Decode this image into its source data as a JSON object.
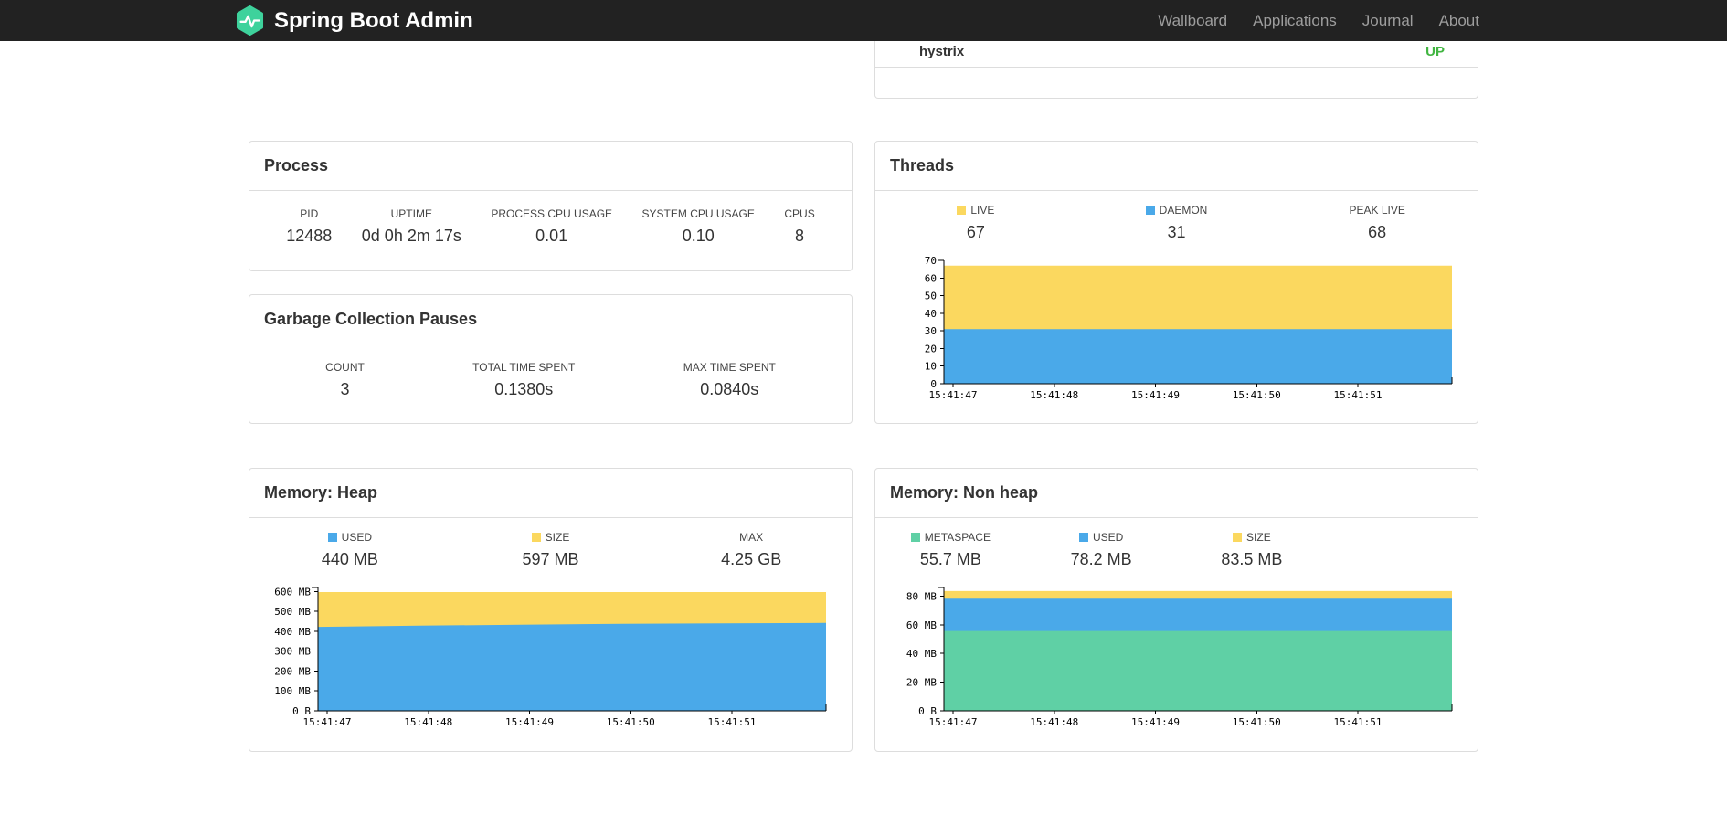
{
  "navbar": {
    "brand": "Spring Boot Admin",
    "links": [
      "Wallboard",
      "Applications",
      "Journal",
      "About"
    ]
  },
  "status_card": {
    "service": "hystrix",
    "status": "UP",
    "status_color": "#41b541"
  },
  "process": {
    "title": "Process",
    "metrics": [
      {
        "label": "PID",
        "value": "12488"
      },
      {
        "label": "UPTIME",
        "value": "0d 0h 2m 17s"
      },
      {
        "label": "PROCESS CPU USAGE",
        "value": "0.01"
      },
      {
        "label": "SYSTEM CPU USAGE",
        "value": "0.10"
      },
      {
        "label": "CPUS",
        "value": "8"
      }
    ]
  },
  "gc": {
    "title": "Garbage Collection Pauses",
    "metrics": [
      {
        "label": "COUNT",
        "value": "3"
      },
      {
        "label": "TOTAL TIME SPENT",
        "value": "0.1380s"
      },
      {
        "label": "MAX TIME SPENT",
        "value": "0.0840s"
      }
    ]
  },
  "threads_card": {
    "title": "Threads",
    "legend": [
      {
        "label": "LIVE",
        "value": "67",
        "color": "#fbd85f"
      },
      {
        "label": "DAEMON",
        "value": "31",
        "color": "#4aa9e9"
      },
      {
        "label": "PEAK LIVE",
        "value": "68"
      }
    ]
  },
  "heap_card": {
    "title": "Memory: Heap",
    "legend": [
      {
        "label": "USED",
        "value": "440 MB",
        "color": "#4aa9e9"
      },
      {
        "label": "SIZE",
        "value": "597 MB",
        "color": "#fbd85f"
      },
      {
        "label": "MAX",
        "value": "4.25 GB"
      }
    ]
  },
  "nonheap_card": {
    "title": "Memory: Non heap",
    "legend": [
      {
        "label": "METASPACE",
        "value": "55.7 MB",
        "color": "#5fd0a5"
      },
      {
        "label": "USED",
        "value": "78.2 MB",
        "color": "#4aa9e9"
      },
      {
        "label": "SIZE",
        "value": "83.5 MB",
        "color": "#fbd85f"
      }
    ]
  },
  "charts": {
    "threads": {
      "type": "area",
      "title": "Threads",
      "x": [
        "15:41:47",
        "15:41:48",
        "15:41:49",
        "15:41:50",
        "15:41:51"
      ],
      "ylim": [
        0,
        70
      ],
      "yticks": [
        {
          "v": 0,
          "label": "0"
        },
        {
          "v": 10,
          "label": "10"
        },
        {
          "v": 20,
          "label": "20"
        },
        {
          "v": 30,
          "label": "30"
        },
        {
          "v": 40,
          "label": "40"
        },
        {
          "v": 50,
          "label": "50"
        },
        {
          "v": 60,
          "label": "60"
        },
        {
          "v": 70,
          "label": "70"
        }
      ],
      "series": [
        {
          "name": "DAEMON",
          "color": "#4aa9e9",
          "values": [
            31,
            31,
            31,
            31,
            31,
            31
          ]
        },
        {
          "name": "LIVE",
          "color": "#fbd85f",
          "values": [
            67,
            67,
            67,
            67,
            67,
            67
          ]
        }
      ]
    },
    "heap": {
      "type": "area",
      "title": "Memory: Heap",
      "x": [
        "15:41:47",
        "15:41:48",
        "15:41:49",
        "15:41:50",
        "15:41:51"
      ],
      "ylim": [
        0,
        620
      ],
      "yticks": [
        {
          "v": 0,
          "label": "0 B"
        },
        {
          "v": 100,
          "label": "100 MB"
        },
        {
          "v": 200,
          "label": "200 MB"
        },
        {
          "v": 300,
          "label": "300 MB"
        },
        {
          "v": 400,
          "label": "400 MB"
        },
        {
          "v": 500,
          "label": "500 MB"
        },
        {
          "v": 600,
          "label": "600 MB"
        }
      ],
      "series": [
        {
          "name": "USED",
          "color": "#4aa9e9",
          "values": [
            422,
            428,
            433,
            437,
            440,
            442
          ]
        },
        {
          "name": "SIZE",
          "color": "#fbd85f",
          "values": [
            597,
            597,
            597,
            597,
            597,
            597
          ]
        }
      ]
    },
    "nonheap": {
      "type": "area",
      "title": "Memory: Non heap",
      "x": [
        "15:41:47",
        "15:41:48",
        "15:41:49",
        "15:41:50",
        "15:41:51"
      ],
      "ylim": [
        0,
        86
      ],
      "yticks": [
        {
          "v": 0,
          "label": "0 B"
        },
        {
          "v": 20,
          "label": "20 MB"
        },
        {
          "v": 40,
          "label": "40 MB"
        },
        {
          "v": 60,
          "label": "60 MB"
        },
        {
          "v": 80,
          "label": "80 MB"
        }
      ],
      "series": [
        {
          "name": "METASPACE",
          "color": "#5fd0a5",
          "values": [
            55.7,
            55.7,
            55.7,
            55.7,
            55.7,
            55.7
          ]
        },
        {
          "name": "USED",
          "color": "#4aa9e9",
          "values": [
            78.2,
            78.2,
            78.2,
            78.2,
            78.2,
            78.2
          ]
        },
        {
          "name": "SIZE",
          "color": "#fbd85f",
          "values": [
            83.5,
            83.5,
            83.5,
            83.5,
            83.5,
            83.5
          ]
        }
      ]
    }
  }
}
